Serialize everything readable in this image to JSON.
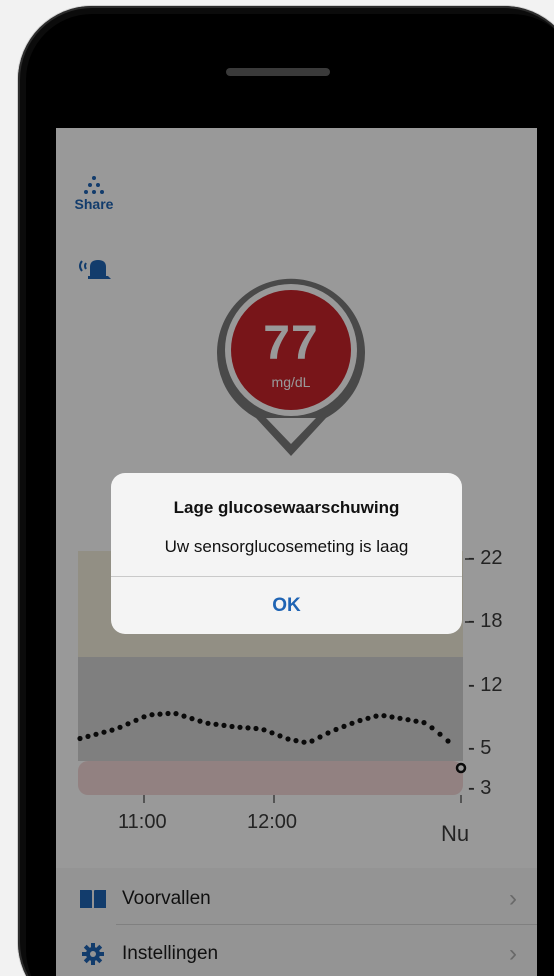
{
  "app": {
    "share_label": "Share",
    "glucose": {
      "value": "77",
      "unit": "mg/dL",
      "color": "#c8232b"
    },
    "graph": {
      "y_ticks": [
        "22",
        "18",
        "12",
        "5",
        "3"
      ],
      "x_ticks": [
        "11:00",
        "12:00",
        "Nu"
      ],
      "zones": {
        "high": "#f3eedd",
        "target": "#d4d4d4",
        "low": "#f3d8d8"
      },
      "series_color": "#111111"
    },
    "menu": [
      {
        "label": "Voorvallen",
        "icon": "book-icon"
      },
      {
        "label": "Instellingen",
        "icon": "gear-icon"
      }
    ]
  },
  "alert": {
    "title": "Lage glucosewaarschuwing",
    "message": "Uw sensorglucosemeting is laag",
    "ok_label": "OK"
  },
  "colors": {
    "accent": "#1f64b4"
  }
}
